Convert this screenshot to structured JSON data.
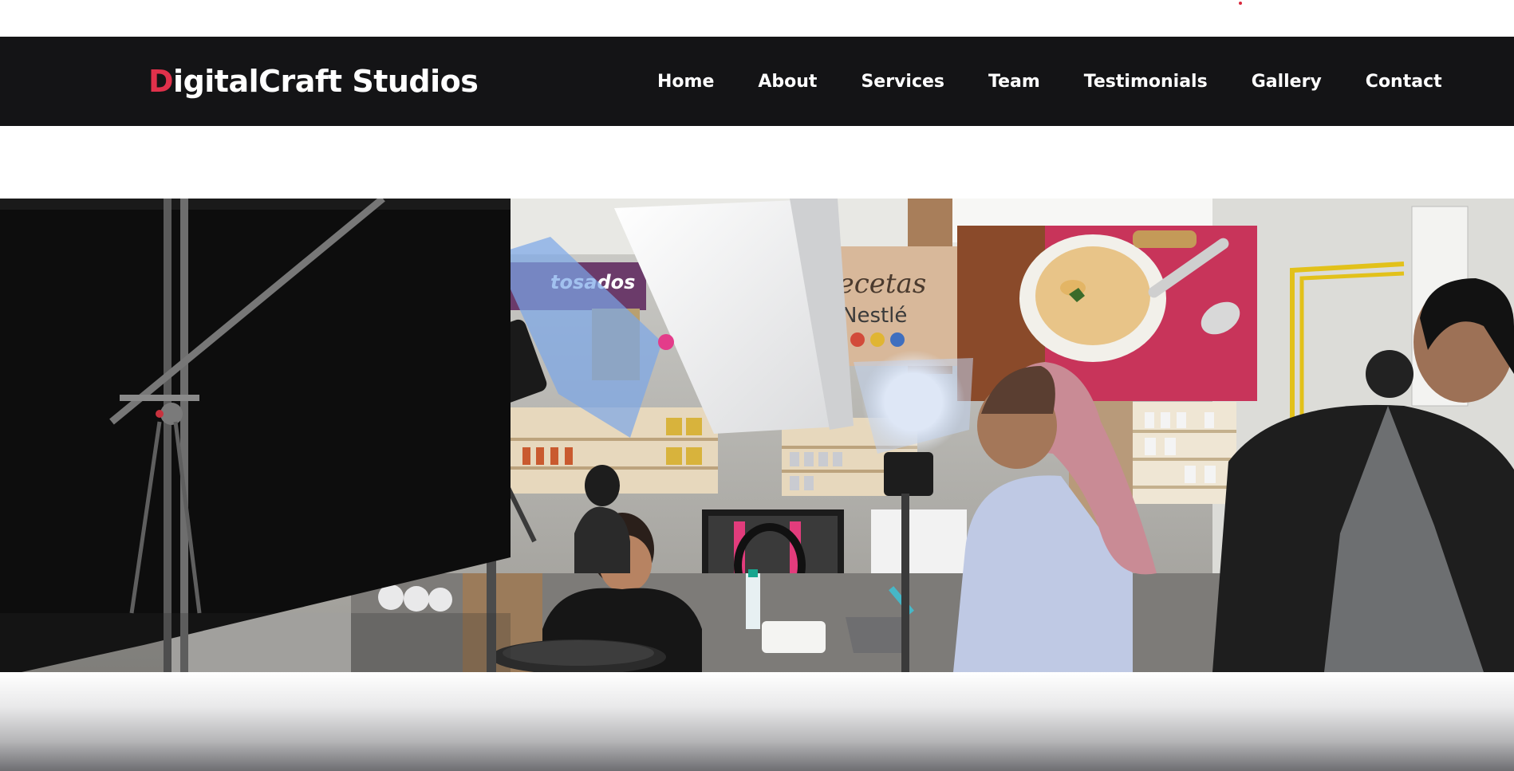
{
  "brand": {
    "first_letter": "D",
    "rest": "igitalCraft Studios"
  },
  "nav": {
    "items": [
      {
        "label": "Home"
      },
      {
        "label": "About"
      },
      {
        "label": "Services"
      },
      {
        "label": "Team"
      },
      {
        "label": "Testimonials"
      },
      {
        "label": "Gallery"
      },
      {
        "label": "Contact"
      }
    ]
  },
  "hero": {
    "signs": {
      "left": "tosados",
      "recetas_line1": "Recetas",
      "recetas_line2": "Nestlé"
    }
  },
  "colors": {
    "accent": "#e0314b",
    "navbar_bg": "#141416",
    "nav_text": "#ffffff"
  }
}
